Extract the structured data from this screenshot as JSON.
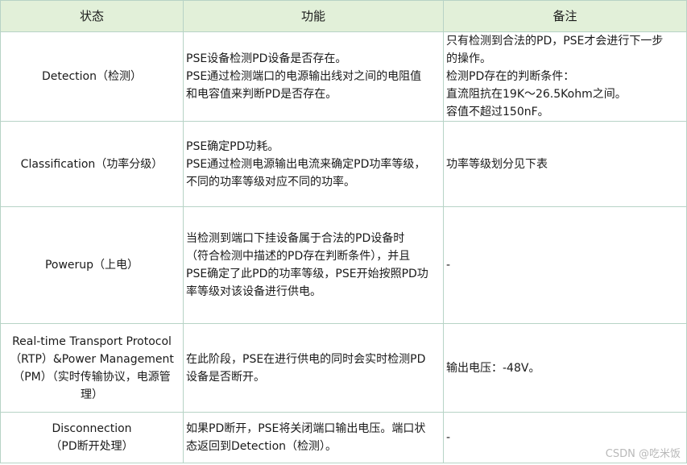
{
  "table": {
    "headers": [
      "状态",
      "功能",
      "备注"
    ],
    "rows": [
      {
        "state": [
          "Detection（检测）"
        ],
        "function": [
          "PSE设备检测PD设备是否存在。",
          "PSE通过检测端口的电源输出线对之间的电阻值",
          "和电容值来判断PD是否存在。"
        ],
        "notes": [
          "只有检测到合法的PD，PSE才会进行下一步",
          "的操作。",
          "检测PD存在的判断条件：",
          "直流阻抗在19K～26.5Kohm之间。",
          "容值不超过150nF。"
        ]
      },
      {
        "state": [
          "Classification（功率分级）"
        ],
        "function": [
          "PSE确定PD功耗。",
          "PSE通过检测电源输出电流来确定PD功率等级，",
          "不同的功率等级对应不同的功率。"
        ],
        "notes": [
          "功率等级划分见下表"
        ]
      },
      {
        "state": [
          "Powerup（上电）"
        ],
        "function": [
          "当检测到端口下挂设备属于合法的PD设备时",
          "（符合检测中描述的PD存在判断条件），并且",
          "PSE确定了此PD的功率等级，PSE开始按照PD功",
          "率等级对该设备进行供电。"
        ],
        "notes": [
          "-"
        ]
      },
      {
        "state": [
          "Real-time Transport Protocol",
          "（RTP）&Power Management",
          "（PM）（实时传输协议，电源管",
          "理）"
        ],
        "function": [
          "在此阶段，PSE在进行供电的同时会实时检测PD",
          "设备是否断开。"
        ],
        "notes": [
          "输出电压：-48V。"
        ]
      },
      {
        "state": [
          "Disconnection",
          "（PD断开处理）"
        ],
        "function": [
          "如果PD断开，PSE将关闭端口输出电压。端口状",
          "态返回到Detection（检测）。"
        ],
        "notes": [
          "-"
        ]
      }
    ]
  },
  "watermark": "CSDN @吃米饭"
}
